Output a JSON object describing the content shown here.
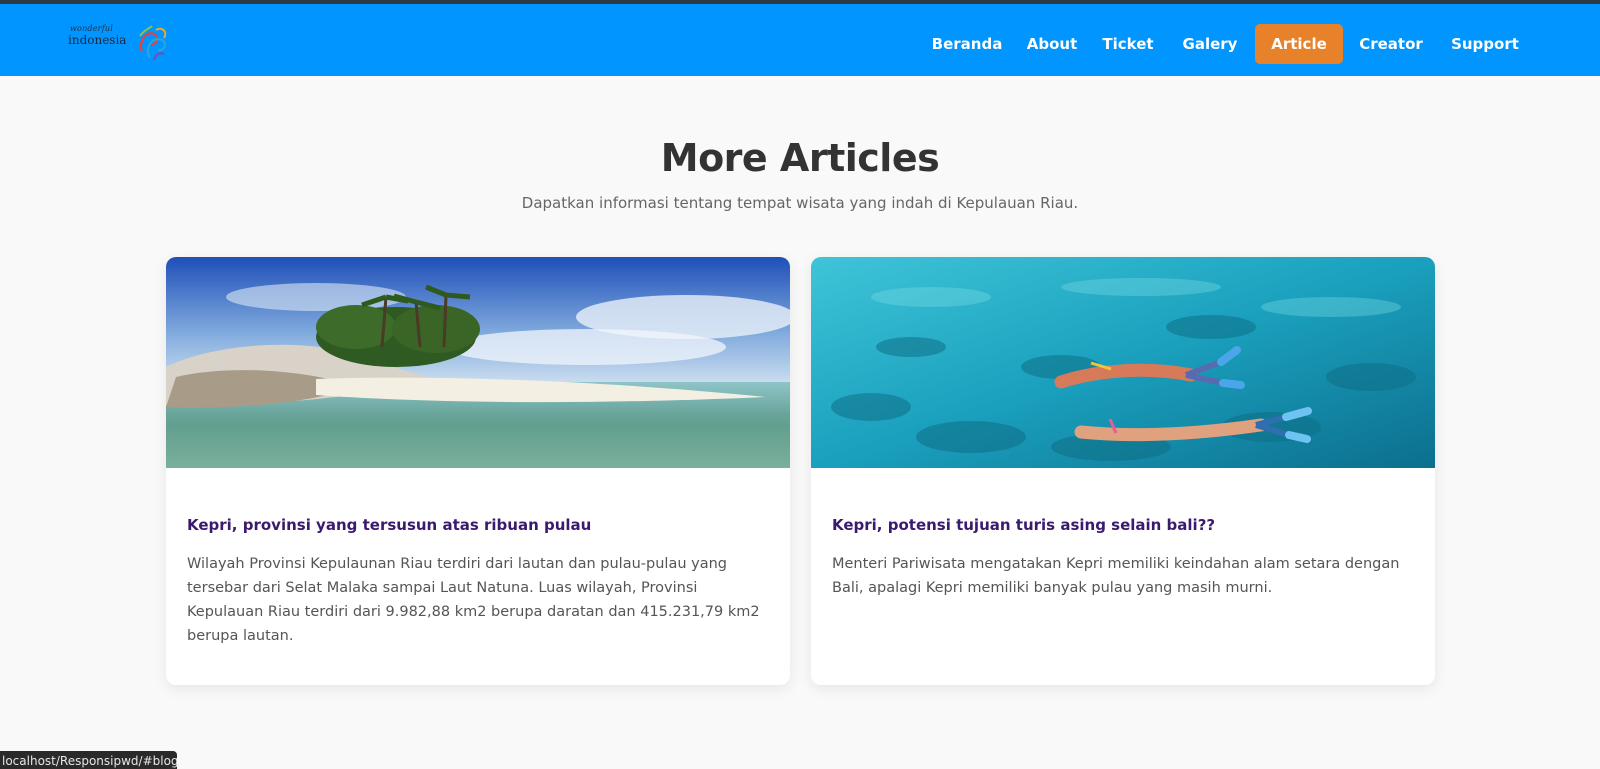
{
  "logo": {
    "script_text": "wonderful",
    "word_text": "indonesia"
  },
  "nav": {
    "items": [
      {
        "label": "Beranda",
        "active": false
      },
      {
        "label": "About",
        "active": false
      },
      {
        "label": "Ticket",
        "active": false
      },
      {
        "label": "Galery",
        "active": false
      },
      {
        "label": "Article",
        "active": true
      },
      {
        "label": "Creator",
        "active": false
      },
      {
        "label": "Support",
        "active": false
      }
    ]
  },
  "section": {
    "title": "More Articles",
    "subtitle": "Dapatkan informasi tentang tempat wisata yang indah di Kepulauan Riau."
  },
  "articles": [
    {
      "title": "Kepri, provinsi yang tersusun atas ribuan pulau",
      "body": "Wilayah Provinsi Kepulaunan Riau terdiri dari lautan dan pulau-pulau yang tersebar dari Selat Malaka sampai Laut Natuna. Luas wilayah, Provinsi Kepulauan Riau terdiri dari 9.982,88 km2 berupa daratan dan 415.231,79 km2 berupa lautan."
    },
    {
      "title": "Kepri, potensi tujuan turis asing selain bali??",
      "body": "Menteri Pariwisata mengatakan Kepri memiliki keindahan alam setara dengan Bali, apalagi Kepri memiliki banyak pulau yang masih murni."
    }
  ],
  "status_bar": {
    "url": "localhost/Responsipwd/#blog"
  },
  "colors": {
    "navbar": "#0095ff",
    "active_nav": "#e8822a",
    "article_title": "#3a1a6e",
    "page_bg": "#f9f9f9"
  }
}
